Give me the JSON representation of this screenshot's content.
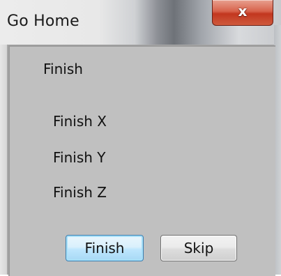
{
  "window": {
    "title": "Go Home",
    "close_icon": "close-icon",
    "close_glyph": "x"
  },
  "dialog": {
    "heading": "Finish",
    "items": [
      "Finish X",
      "Finish Y",
      "Finish Z"
    ],
    "finish_label": "Finish",
    "skip_label": "Skip"
  },
  "colors": {
    "close_button": "#c2371f",
    "client_background": "#c0c0c0",
    "default_button_border": "#3c7fb1"
  }
}
